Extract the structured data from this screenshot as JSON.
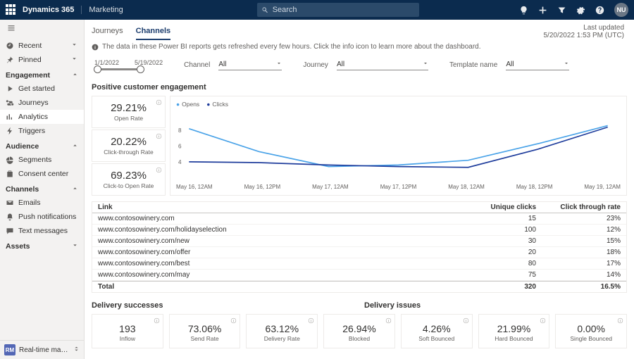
{
  "topbar": {
    "brand": "Dynamics 365",
    "module": "Marketing",
    "search_placeholder": "Search",
    "avatar_initials": "NU"
  },
  "last_updated": {
    "label": "Last updated",
    "value": "5/20/2022 1:53 PM (UTC)"
  },
  "sidebar": {
    "recent": "Recent",
    "pinned": "Pinned",
    "groups": {
      "engagement": "Engagement",
      "audience": "Audience",
      "channels": "Channels",
      "assets": "Assets"
    },
    "items": {
      "get_started": "Get started",
      "journeys": "Journeys",
      "analytics": "Analytics",
      "triggers": "Triggers",
      "segments": "Segments",
      "consent": "Consent center",
      "emails": "Emails",
      "push": "Push notifications",
      "text": "Text messages"
    },
    "area": {
      "initials": "RM",
      "label": "Real-time marketi..."
    }
  },
  "tabs": {
    "journeys": "Journeys",
    "channels": "Channels"
  },
  "info_text": "The data in these Power BI reports gets refreshed every few hours. Click the info icon to learn more about the dashboard.",
  "date_range": {
    "start": "1/1/2022",
    "end": "5/19/2022"
  },
  "filters": {
    "channel": {
      "label": "Channel",
      "value": "All"
    },
    "journey": {
      "label": "Journey",
      "value": "All"
    },
    "template": {
      "label": "Template name",
      "value": "All"
    }
  },
  "sections": {
    "engagement": "Positive customer engagement",
    "successes": "Delivery successes",
    "issues": "Delivery issues"
  },
  "metrics": {
    "open_rate": {
      "value": "29.21%",
      "label": "Open Rate"
    },
    "ctr": {
      "value": "20.22%",
      "label": "Click-through Rate"
    },
    "cto": {
      "value": "69.23%",
      "label": "Click-to Open Rate"
    },
    "inflow": {
      "value": "193",
      "label": "Inflow"
    },
    "send_rate": {
      "value": "73.06%",
      "label": "Send Rate"
    },
    "delivery_rate": {
      "value": "63.12%",
      "label": "Delivery Rate"
    },
    "blocked": {
      "value": "26.94%",
      "label": "Blocked"
    },
    "soft_bounce": {
      "value": "4.26%",
      "label": "Soft Bounced"
    },
    "hard_bounce": {
      "value": "21.99%",
      "label": "Hard Bounced"
    },
    "single_bounce": {
      "value": "0.00%",
      "label": "Single Bounced"
    }
  },
  "legend": {
    "opens": "Opens",
    "clicks": "Clicks"
  },
  "chart_data": {
    "type": "line",
    "x_labels": [
      "May 16, 12AM",
      "May 16, 12PM",
      "May 17, 12AM",
      "May 17, 12PM",
      "May 18, 12AM",
      "May 18, 12PM",
      "May 19, 12AM"
    ],
    "y_ticks": [
      4,
      6,
      8
    ],
    "series": [
      {
        "name": "Opens",
        "values": [
          8.2,
          5.3,
          3.4,
          3.6,
          4.2,
          6.3,
          8.6
        ]
      },
      {
        "name": "Clicks",
        "values": [
          4.0,
          3.9,
          3.6,
          3.4,
          3.3,
          5.6,
          8.4
        ]
      }
    ]
  },
  "link_table": {
    "headers": {
      "link": "Link",
      "clicks": "Unique clicks",
      "rate": "Click through rate"
    },
    "rows": [
      {
        "link": "www.contosowinery.com",
        "clicks": "15",
        "rate": "23%"
      },
      {
        "link": "www.contosowinery.com/holidayselection",
        "clicks": "100",
        "rate": "12%"
      },
      {
        "link": "www.contosowinery.com/new",
        "clicks": "30",
        "rate": "15%"
      },
      {
        "link": "www.contosowinery.com/offer",
        "clicks": "20",
        "rate": "18%"
      },
      {
        "link": "www.contosowinery.com/best",
        "clicks": "80",
        "rate": "17%"
      },
      {
        "link": "www.contosowinery.com/may",
        "clicks": "75",
        "rate": "14%"
      }
    ],
    "total": {
      "label": "Total",
      "clicks": "320",
      "rate": "16.5%"
    }
  }
}
